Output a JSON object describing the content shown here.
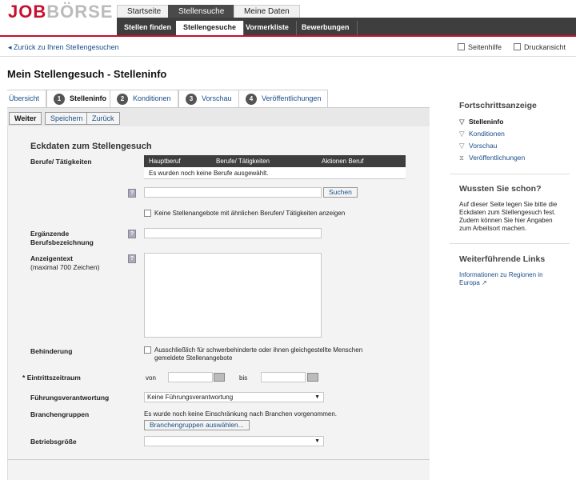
{
  "logo": {
    "red": "JOB",
    "grey": "BÖRSE"
  },
  "top_tabs": [
    {
      "label": "Startseite"
    },
    {
      "label": "Stellensuche"
    },
    {
      "label": "Meine Daten"
    }
  ],
  "sub_tabs": [
    {
      "label": "Stellen finden"
    },
    {
      "label": "Stellengesuche"
    },
    {
      "label": "Vormerkliste"
    },
    {
      "label": "Bewerbungen"
    }
  ],
  "back_link": "Zurück zu Ihren Stellengesuchen",
  "utilities": {
    "help": "Seitenhilfe",
    "print": "Druckansicht"
  },
  "page_title": "Mein Stellengesuch - Stelleninfo",
  "steps": [
    {
      "label": "Übersicht"
    },
    {
      "num": "1",
      "label": "Stelleninfo"
    },
    {
      "num": "2",
      "label": "Konditionen"
    },
    {
      "num": "3",
      "label": "Vorschau"
    },
    {
      "num": "4",
      "label": "Veröffentlichungen"
    }
  ],
  "buttons": {
    "next": "Weiter",
    "save": "Speichern",
    "back": "Zurück"
  },
  "form": {
    "section_title": "Eckdaten zum Stellengesuch",
    "occupations_label": "Berufe/ Tätigkeiten",
    "table_headers": [
      "Hauptberuf",
      "Berufe/ Tätigkeiten",
      "Aktionen Beruf"
    ],
    "table_empty": "Es wurden noch keine Berufe ausgewählt.",
    "search_button": "Suchen",
    "no_similar_label": "Keine Stellenangebote mit ähnlichen Berufen/ Tätigkeiten anzeigen",
    "extra_title_label_1": "Ergänzende",
    "extra_title_label_2": "Berufsbezeichnung",
    "ad_text_label": "Anzeigentext",
    "ad_text_hint": "(maximal 700 Zeichen)",
    "disability_label": "Behinderung",
    "disability_text_1": "Ausschließlich für schwerbehinderte oder ihnen gleichgestellte Menschen",
    "disability_text_2": "gemeldete Stellenangebote",
    "required_mark": "*",
    "start_label": "Eintrittszeitraum",
    "from_label": "von",
    "to_label": "bis",
    "leadership_label": "Führungsverantwortung",
    "leadership_value": "Keine Führungsverantwortung",
    "industry_label": "Branchengruppen",
    "industry_text": "Es wurde noch keine Einschränkung nach Branchen vorgenommen.",
    "industry_button": "Branchengruppen auswählen...",
    "company_size_label": "Betriebsgröße",
    "company_size_value": ""
  },
  "sidebar": {
    "progress_title": "Fortschrittsanzeige",
    "progress_items": [
      {
        "label": "Stelleninfo",
        "active": true
      },
      {
        "label": "Konditionen",
        "active": false
      },
      {
        "label": "Vorschau",
        "active": false
      },
      {
        "label": "Veröffentlichungen",
        "active": false
      }
    ],
    "did_you_know_title": "Wussten Sie schon?",
    "did_you_know_lines": [
      "Auf dieser Seite legen Sie bitte die",
      "Eckdaten zum Stellengesuch fest.",
      "Zudem können Sie hier Angaben",
      "zum Arbeitsort machen."
    ],
    "links_title": "Weiterführende Links",
    "link_line_1": "Informationen zu Regionen in",
    "link_line_2": "Europa"
  },
  "colors": {
    "brand_red": "#c8102e",
    "nav_dark": "#3e3e3e",
    "link_blue": "#1b4e8a"
  }
}
